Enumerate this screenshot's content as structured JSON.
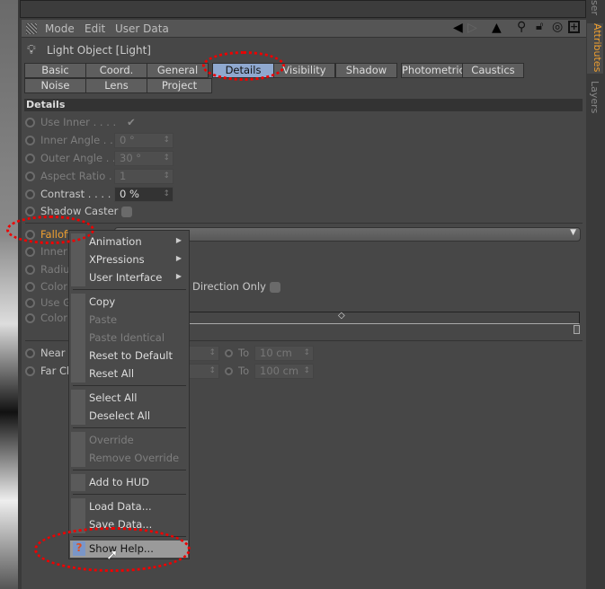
{
  "right_tabs": {
    "top": "ser",
    "attributes": "Attributes",
    "layers": "Layers"
  },
  "menubar": {
    "mode": "Mode",
    "edit": "Edit",
    "user_data": "User Data"
  },
  "object_title": "Light Object [Light]",
  "tabs": [
    "Basic",
    "Coord.",
    "General",
    "Details",
    "Visibility",
    "Shadow",
    "Photometric",
    "Caustics",
    "Noise",
    "Lens",
    "Project"
  ],
  "active_tab": "Details",
  "section": "Details",
  "fields": {
    "use_inner": "Use Inner . . . .",
    "inner_angle": "Inner Angle . .",
    "inner_angle_val": "0 °",
    "outer_angle": "Outer Angle . .",
    "outer_angle_val": "30 °",
    "aspect_ratio": "Aspect Ratio .",
    "aspect_ratio_val": "1",
    "contrast": "Contrast . . . . .",
    "contrast_val": "0 %",
    "shadow_caster": "Shadow Caster",
    "falloff": "Falloff",
    "inner": "Inner",
    "radius": "Radiu",
    "color1": "Color",
    "direction_only": "Direction Only",
    "use_g": "Use G",
    "color2": "Color",
    "near": "Near",
    "far": "Far Cl",
    "to": "To",
    "near_to_val": "10 cm",
    "far_to_val": "100 cm"
  },
  "context_menu": [
    {
      "label": "Animation",
      "submenu": true
    },
    {
      "label": "XPressions",
      "submenu": true
    },
    {
      "label": "User Interface",
      "submenu": true
    },
    {
      "label": "Copy"
    },
    {
      "label": "Paste",
      "disabled": true
    },
    {
      "label": "Paste Identical",
      "disabled": true
    },
    {
      "label": "Reset to Default"
    },
    {
      "label": "Reset All"
    },
    {
      "label": "Select All"
    },
    {
      "label": "Deselect All"
    },
    {
      "label": "Override",
      "disabled": true
    },
    {
      "label": "Remove Override",
      "disabled": true
    },
    {
      "label": "Add to HUD"
    },
    {
      "label": "Load Data..."
    },
    {
      "label": "Save Data..."
    },
    {
      "label": "Show Help...",
      "highlighted": true,
      "icon": "help-icon"
    }
  ],
  "colors": {
    "accent_tab": "#8fa8cf",
    "highlight_label": "#f0a030",
    "annotation": "#e00000"
  }
}
